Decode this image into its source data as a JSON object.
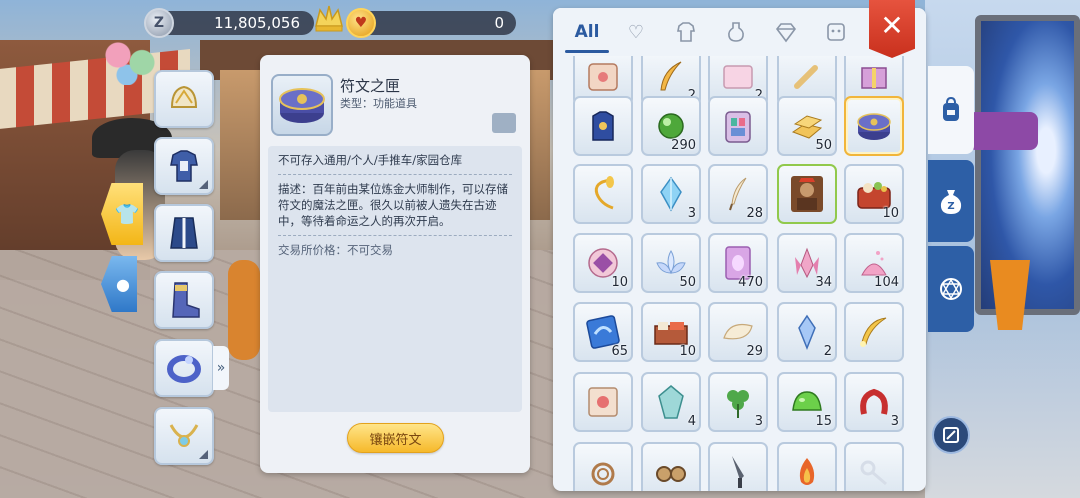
{
  "currency": {
    "zeny_symbol": "Z",
    "zeny": "11,805,056",
    "gold": "0"
  },
  "item_detail": {
    "name": "符文之匣",
    "type": "类型：功能道具",
    "restriction": "不可存入通用/个人/手推车/家园仓库",
    "description": "描述：百年前由某位炼金大师制作，可以存储符文的魔法之匣。很久以前被人遗失在古迹中，等待着命运之人的再次开启。",
    "trade_price": "交易所价格：不可交易",
    "embed_button": "镶嵌符文"
  },
  "inventory": {
    "tabs": [
      {
        "label": "All",
        "icon": null,
        "active": true
      },
      {
        "label": "",
        "icon": "heart-icon",
        "active": false
      },
      {
        "label": "",
        "icon": "armor-icon",
        "active": false
      },
      {
        "label": "",
        "icon": "potion-icon",
        "active": false
      },
      {
        "label": "",
        "icon": "gem-icon",
        "active": false
      },
      {
        "label": "",
        "icon": "card-icon",
        "active": false
      }
    ],
    "close_label": "✕",
    "rows": [
      [
        {
          "icon": "scroll-icon",
          "qty": ""
        },
        {
          "icon": "feather-icon",
          "qty": "2"
        },
        {
          "icon": "box-icon",
          "qty": "2"
        },
        {
          "icon": "bone-icon",
          "qty": ""
        },
        {
          "icon": "gift-icon",
          "qty": ""
        }
      ],
      [
        {
          "icon": "blue-armor-icon",
          "qty": ""
        },
        {
          "icon": "green-orb-icon",
          "qty": "290"
        },
        {
          "icon": "backpack-icon",
          "qty": ""
        },
        {
          "icon": "gold-bars-icon",
          "qty": "50"
        },
        {
          "icon": "rune-box-icon",
          "qty": "",
          "selected": true
        }
      ],
      [
        {
          "icon": "golden-whip-icon",
          "qty": ""
        },
        {
          "icon": "blue-crystal-icon",
          "qty": "3"
        },
        {
          "icon": "quill-icon",
          "qty": "28"
        },
        {
          "icon": "monster-card-icon",
          "qty": "",
          "green": true
        },
        {
          "icon": "bento-icon",
          "qty": "10"
        }
      ],
      [
        {
          "icon": "rune-stone-icon",
          "qty": "10"
        },
        {
          "icon": "lotus-icon",
          "qty": "50"
        },
        {
          "icon": "pink-card-icon",
          "qty": "470"
        },
        {
          "icon": "pink-crystal-icon",
          "qty": "34"
        },
        {
          "icon": "pink-dust-icon",
          "qty": "104"
        }
      ],
      [
        {
          "icon": "blue-ticket-icon",
          "qty": "65"
        },
        {
          "icon": "lunch-box-icon",
          "qty": "10"
        },
        {
          "icon": "cream-icon",
          "qty": "29"
        },
        {
          "icon": "ice-shard-icon",
          "qty": "2"
        },
        {
          "icon": "gold-feather-icon",
          "qty": ""
        }
      ],
      [
        {
          "icon": "recipe-scroll-icon",
          "qty": ""
        },
        {
          "icon": "aqua-gem-icon",
          "qty": "4"
        },
        {
          "icon": "clover-icon",
          "qty": "3"
        },
        {
          "icon": "green-jelly-icon",
          "qty": "15"
        },
        {
          "icon": "red-ribbon-icon",
          "qty": "3"
        }
      ],
      [
        {
          "icon": "rope-icon",
          "qty": ""
        },
        {
          "icon": "goggles-icon",
          "qty": ""
        },
        {
          "icon": "dagger-icon",
          "qty": ""
        },
        {
          "icon": "flame-icon",
          "qty": ""
        },
        {
          "icon": "key-icon",
          "qty": ""
        }
      ]
    ]
  },
  "colors": {
    "accent_blue": "#2d5fa6",
    "close_red": "#d63a25",
    "selected_border": "#f1b53a",
    "embed_button": "#f6b92b"
  }
}
